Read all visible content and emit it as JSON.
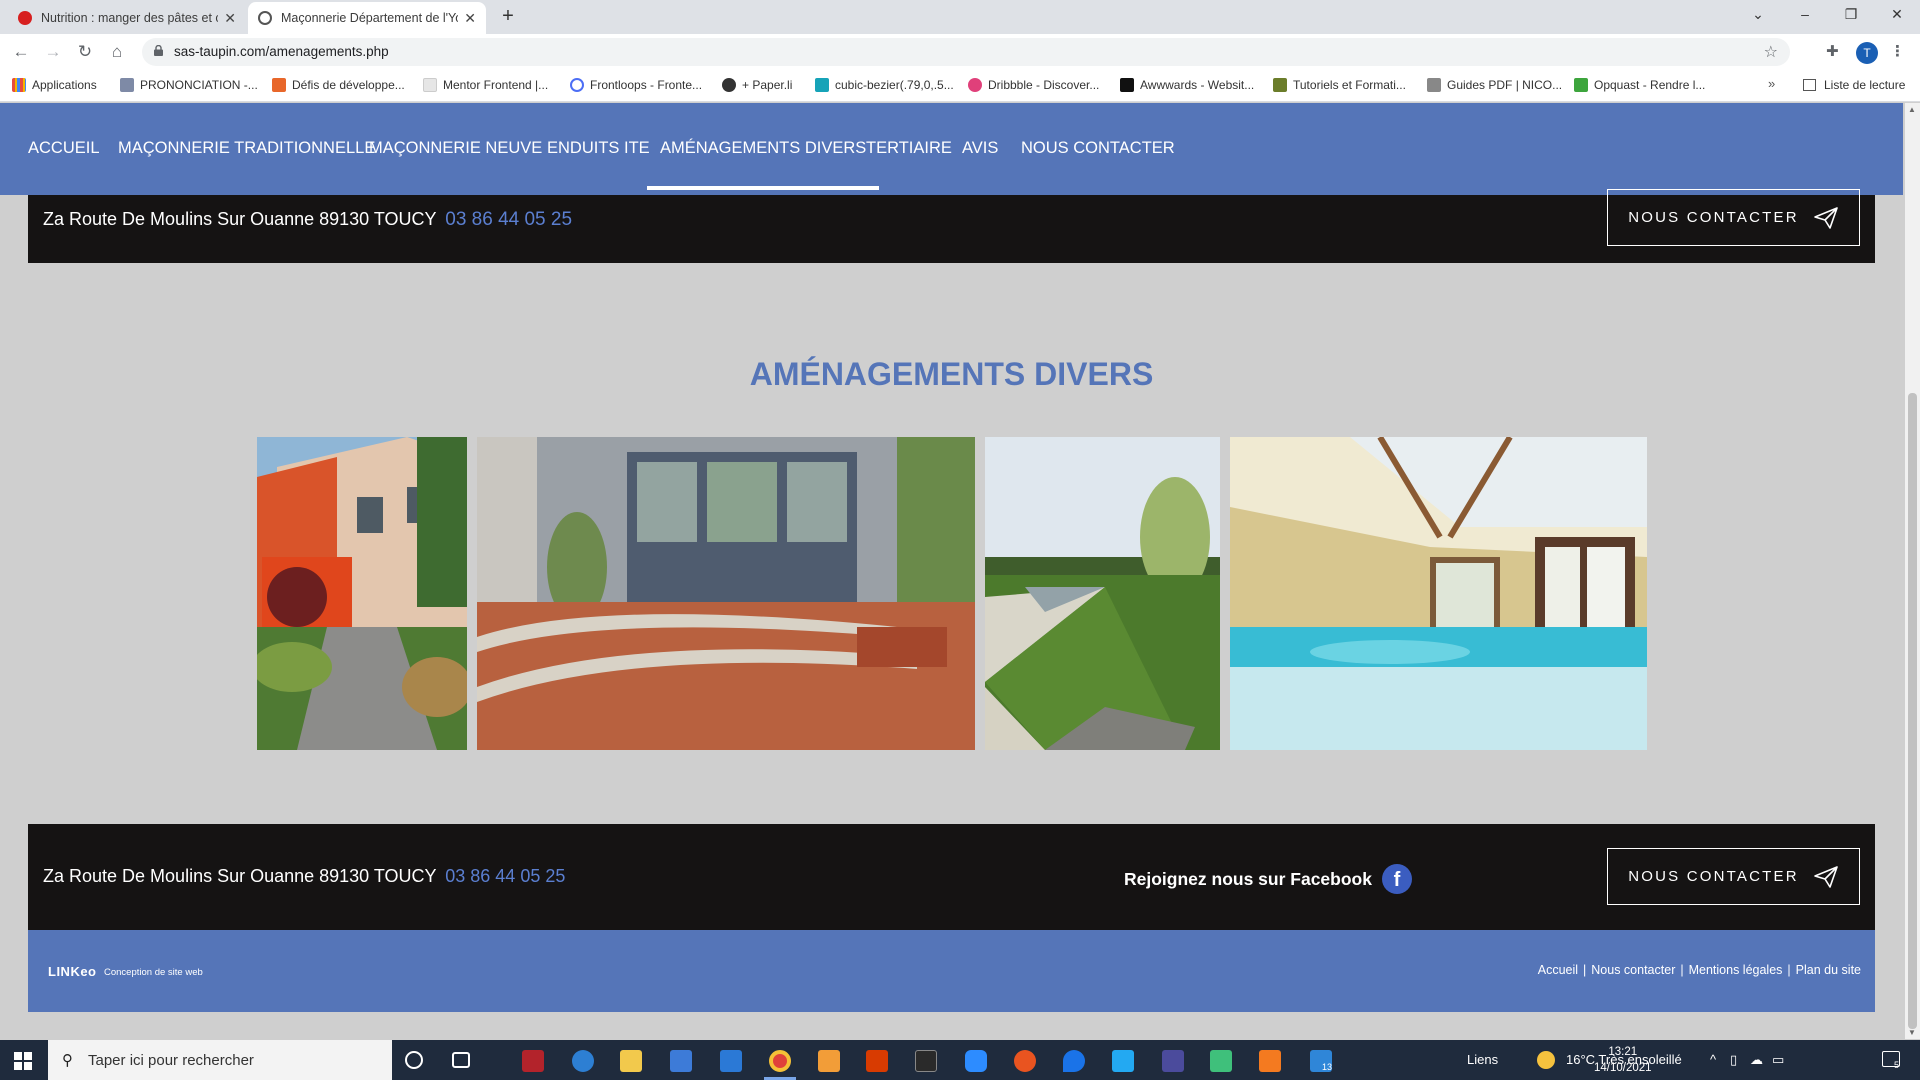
{
  "browser": {
    "tabs": [
      {
        "title": "Nutrition : manger des pâtes et c",
        "favicon_color": "#d71f1f"
      },
      {
        "title": "Maçonnerie Département de l'Yo",
        "favicon_color": "#555555"
      }
    ],
    "url": "sas-taupin.com/amenagements.php",
    "profile_initial": "T",
    "bookmarks": [
      {
        "label": "Applications",
        "icon_color": "#e84c3d"
      },
      {
        "label": "PRONONCIATION -...",
        "icon_color": "#7e8aa6"
      },
      {
        "label": "Défis de développe...",
        "icon_color": "#e8672a"
      },
      {
        "label": "Mentor Frontend |...",
        "icon_color": "#cccccc"
      },
      {
        "label": "Frontloops - Fronte...",
        "icon_color": "#4c6ef5"
      },
      {
        "label": "+ Paper.li",
        "icon_color": "#333333"
      },
      {
        "label": "cubic-bezier(.79,0,.5...",
        "icon_color": "#16a3b8"
      },
      {
        "label": "Dribbble - Discover...",
        "icon_color": "#e0407a"
      },
      {
        "label": "Awwwards - Websit...",
        "icon_color": "#111111"
      },
      {
        "label": "Tutoriels et Formati...",
        "icon_color": "#6b7d2a"
      },
      {
        "label": "Guides PDF | NICO...",
        "icon_color": "#888888"
      },
      {
        "label": "Opquast - Rendre l...",
        "icon_color": "#3da53d"
      }
    ],
    "bookmarks_more": "»",
    "reading_list": "Liste de lecture"
  },
  "site": {
    "nav": [
      {
        "label": "ACCUEIL",
        "active": false
      },
      {
        "label": "MAÇONNERIE TRADITIONNELLE",
        "active": false
      },
      {
        "label": "MAÇONNERIE NEUVE",
        "active": false
      },
      {
        "label": "ENDUITS ITE",
        "active": false
      },
      {
        "label": "AMÉNAGEMENTS DIVERS",
        "active": true
      },
      {
        "label": "TERTIAIRE",
        "active": false
      },
      {
        "label": "AVIS",
        "active": false
      },
      {
        "label": "NOUS CONTACTER",
        "active": false
      }
    ],
    "address": "Za Route De Moulins Sur Ouanne 89130 TOUCY",
    "phone": "03 86 44 05 25",
    "contact_button": "NOUS CONTACTER",
    "section_title": "AMÉNAGEMENTS DIVERS",
    "photos": [
      {
        "icon": "garden-path-photo"
      },
      {
        "icon": "terrace-tiles-photo"
      },
      {
        "icon": "pool-lawn-photo"
      },
      {
        "icon": "indoor-pool-photo"
      }
    ],
    "facebook_text": "Rejoignez nous sur Facebook",
    "facebook_icon": "f",
    "footer_brand": "LINKeo",
    "footer_brand_sub": "Conception de site web",
    "legal_links": [
      "Accueil",
      "Nous contacter",
      "Mentions légales",
      "Plan du site"
    ],
    "brand_color": "#5575b8"
  },
  "taskbar": {
    "search_placeholder": "Taper ici pour rechercher",
    "links_label": "Liens",
    "weather": "16°C  Très ensoleillé",
    "time": "13:21",
    "date": "14/10/2021",
    "badge_count": "13",
    "notif_count": "5"
  }
}
